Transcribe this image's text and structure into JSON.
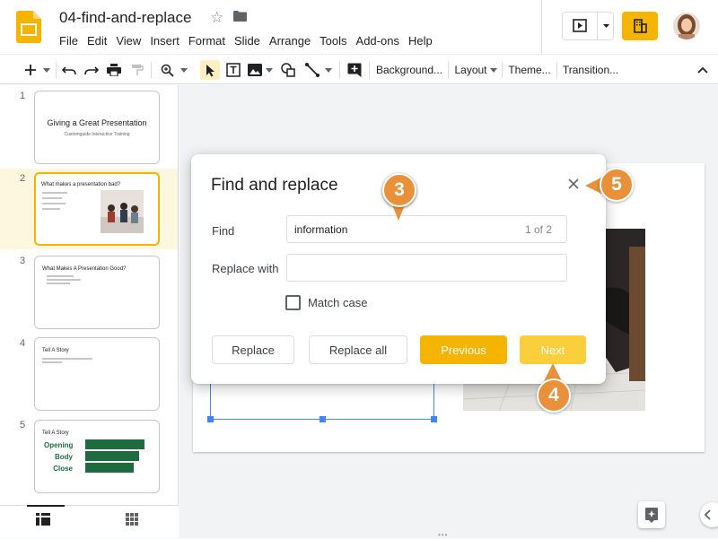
{
  "header": {
    "doc_title": "04-find-and-replace",
    "menu": [
      "File",
      "Edit",
      "View",
      "Insert",
      "Format",
      "Slide",
      "Arrange",
      "Tools",
      "Add-ons",
      "Help"
    ]
  },
  "toolbar": {
    "background_label": "Background...",
    "layout_label": "Layout",
    "theme_label": "Theme...",
    "transition_label": "Transition..."
  },
  "slides": [
    {
      "number": "1",
      "title": "Giving a Great Presentation",
      "subtitle": "Customguide Interactive Training"
    },
    {
      "number": "2",
      "title": "What makes a presentation bad?"
    },
    {
      "number": "3",
      "title": "What Makes A Presentation Good?"
    },
    {
      "number": "4",
      "title": "Tell A Story"
    },
    {
      "number": "5",
      "title": "Tell A Story",
      "labels": [
        "Opening",
        "Body",
        "Close"
      ]
    }
  ],
  "dialog": {
    "title": "Find and replace",
    "find_label": "Find",
    "find_value": "information",
    "match_count": "1 of 2",
    "replace_label": "Replace with",
    "replace_value": "",
    "match_case_label": "Match case",
    "match_case_checked": false,
    "buttons": {
      "replace": "Replace",
      "replace_all": "Replace all",
      "previous": "Previous",
      "next": "Next"
    }
  },
  "callouts": [
    "3",
    "4",
    "5"
  ],
  "colors": {
    "accent": "#f5b400",
    "callout": "#e8913a",
    "selection": "#4285f4",
    "story_bar": "#1e6b3f"
  }
}
